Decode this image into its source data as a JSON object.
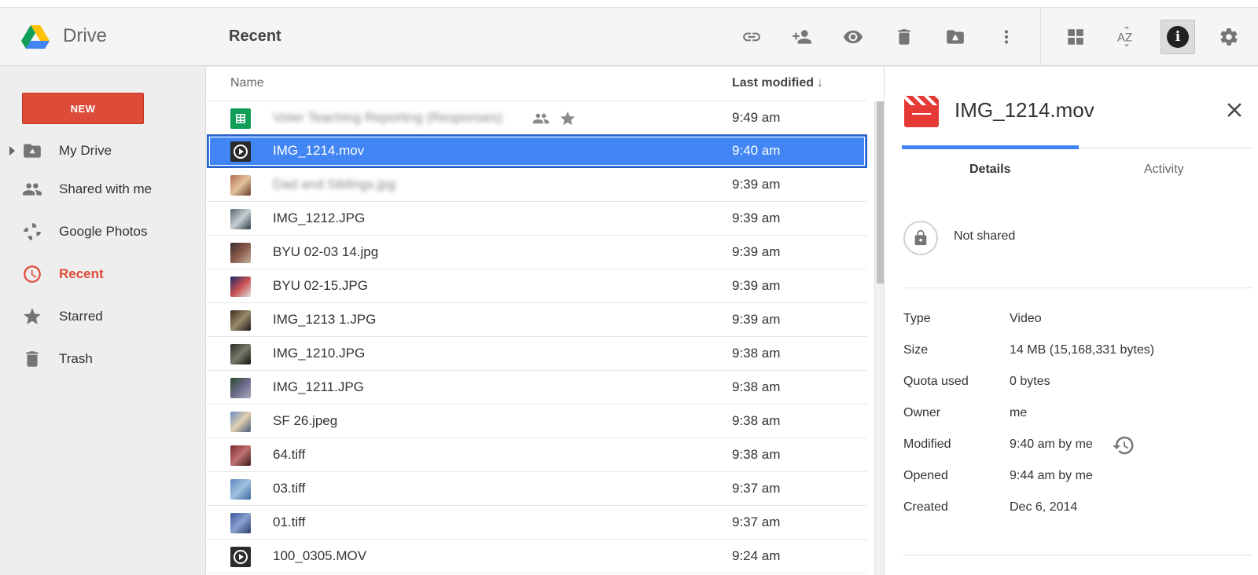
{
  "app": {
    "name": "Drive",
    "page_title": "Recent"
  },
  "toolbar": {
    "icons": [
      "link-icon",
      "add-person-icon",
      "eye-icon",
      "trash-icon",
      "move-to-drive-icon",
      "more-vert-icon",
      "grid-view-icon",
      "sort-az-icon",
      "info-icon",
      "gear-icon"
    ]
  },
  "sidebar": {
    "new_label": "NEW",
    "items": [
      {
        "label": "My Drive",
        "icon": "drive-folder-icon"
      },
      {
        "label": "Shared with me",
        "icon": "people-icon"
      },
      {
        "label": "Google Photos",
        "icon": "pinwheel-icon"
      },
      {
        "label": "Recent",
        "icon": "clock-icon",
        "active": true
      },
      {
        "label": "Starred",
        "icon": "star-icon"
      },
      {
        "label": "Trash",
        "icon": "trash-icon"
      }
    ]
  },
  "list": {
    "col_name": "Name",
    "col_modified": "Last modified",
    "sort_arrow": "↓",
    "rows": [
      {
        "name": "Voter Teaching Reporting (Responses)",
        "time": "9:49 am",
        "blurred": true
      },
      {
        "name": "IMG_1214.mov",
        "time": "9:40 am",
        "selected": true
      },
      {
        "name": "Dad and Siblings.jpg",
        "time": "9:39 am",
        "blurred": true
      },
      {
        "name": "IMG_1212.JPG",
        "time": "9:39 am"
      },
      {
        "name": "BYU 02-03 14.jpg",
        "time": "9:39 am"
      },
      {
        "name": "BYU 02-15.JPG",
        "time": "9:39 am"
      },
      {
        "name": "IMG_1213 1.JPG",
        "time": "9:39 am"
      },
      {
        "name": "IMG_1210.JPG",
        "time": "9:38 am"
      },
      {
        "name": "IMG_1211.JPG",
        "time": "9:38 am"
      },
      {
        "name": "SF 26.jpeg",
        "time": "9:38 am"
      },
      {
        "name": "64.tiff",
        "time": "9:38 am"
      },
      {
        "name": "03.tiff",
        "time": "9:37 am"
      },
      {
        "name": "01.tiff",
        "time": "9:37 am"
      },
      {
        "name": "100_0305.MOV",
        "time": "9:24 am"
      }
    ]
  },
  "details": {
    "title": "IMG_1214.mov",
    "tab_details": "Details",
    "tab_activity": "Activity",
    "share_status": "Not shared",
    "props": [
      {
        "label": "Type",
        "value": "Video"
      },
      {
        "label": "Size",
        "value": "14 MB (15,168,331 bytes)"
      },
      {
        "label": "Quota used",
        "value": "0 bytes"
      },
      {
        "label": "Owner",
        "value": "me"
      },
      {
        "label": "Modified",
        "value": "9:40 am by me"
      },
      {
        "label": "Opened",
        "value": "9:44 am by me"
      },
      {
        "label": "Created",
        "value": "Dec 6, 2014"
      }
    ]
  }
}
